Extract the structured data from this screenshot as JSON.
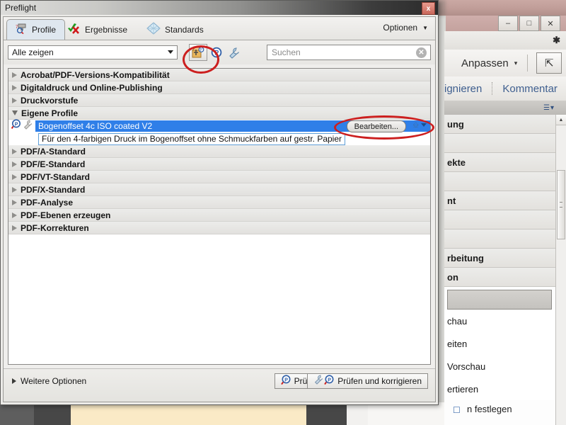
{
  "dialog": {
    "title": "Preflight",
    "close_label": "x",
    "close_icon": "close-icon",
    "tabs": [
      {
        "label": "Profile",
        "icon": "preflight-profile-icon",
        "active": true
      },
      {
        "label": "Ergebnisse",
        "icon": "green-check-red-x-icon",
        "active": false
      },
      {
        "label": "Standards",
        "icon": "blue-diamond-icon",
        "active": false
      }
    ],
    "options_menu": {
      "label": "Optionen",
      "icon": "chevron-down-icon"
    },
    "filterbar": {
      "combo_value": "Alle zeigen",
      "combo_icon": "chevron-down-icon",
      "buttons": [
        {
          "name": "new-profile-icon",
          "glyph": "P"
        },
        {
          "name": "preflight-p-icon",
          "glyph": "P"
        },
        {
          "name": "wrench-icon",
          "glyph": "wrench"
        }
      ],
      "search_placeholder": "Suchen",
      "search_value": "",
      "search_clear_icon": "clear-icon"
    },
    "list": {
      "groups": [
        {
          "label": "Acrobat/PDF-Versions-Kompatibilität",
          "expanded": false
        },
        {
          "label": "Digitaldruck und Online-Publishing",
          "expanded": false
        },
        {
          "label": "Druckvorstufe",
          "expanded": false
        },
        {
          "label": "Eigene Profile",
          "expanded": true
        }
      ],
      "selected_profile": {
        "name": "Bogenoffset 4c ISO coated V2",
        "description": "Für den 4-farbigen Druck im Bogenoffset ohne Schmuckfarben auf gestr. Papier",
        "edit_button": "Bearbeiten...",
        "icons": [
          "preflight-p-icon",
          "wrench-icon"
        ]
      },
      "groups_after": [
        {
          "label": "PDF/A-Standard",
          "expanded": false
        },
        {
          "label": "PDF/E-Standard",
          "expanded": false
        },
        {
          "label": "PDF/VT-Standard",
          "expanded": false
        },
        {
          "label": "PDF/X-Standard",
          "expanded": false
        },
        {
          "label": "PDF-Analyse",
          "expanded": false
        },
        {
          "label": "PDF-Ebenen erzeugen",
          "expanded": false
        },
        {
          "label": "PDF-Korrekturen",
          "expanded": false
        }
      ]
    },
    "footer": {
      "more_options": "Weitere Optionen",
      "check_button": "Prüfen",
      "fix_button": "Prüfen und korrigieren"
    }
  },
  "background": {
    "window_buttons": [
      "–",
      "□",
      "✕"
    ],
    "fit_label": "Anpassen",
    "fit_caret": "▾",
    "expand_icon": "expand-arrows-icon",
    "pin_icon": "pin-icon",
    "tabs": [
      {
        "label": "ignieren"
      },
      {
        "label": "Kommentar"
      }
    ],
    "panel_header_icon": "list-options-icon",
    "panel_rows": [
      "ung",
      "",
      "ekte",
      "",
      "nt",
      "",
      "",
      "rbeitung",
      "on"
    ],
    "menu_rows": [
      "chau",
      "eiten",
      "Vorschau",
      "ertieren",
      "n festlegen"
    ],
    "bottom_icon": "page-icon",
    "bottom_text": "n festlegen"
  },
  "colors": {
    "selection_blue": "#2f7fe8",
    "annotation_red": "#cc1f1f",
    "tab_active_bg": "#dfe7ef",
    "page_thumb": "#faeac6"
  }
}
